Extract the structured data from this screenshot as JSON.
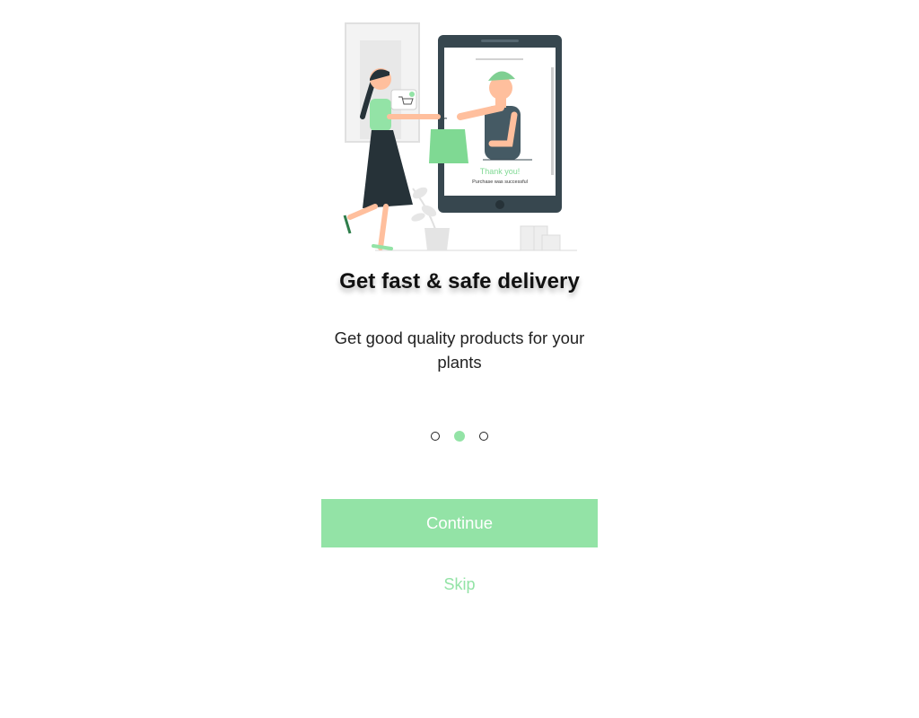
{
  "onboarding": {
    "illustration": {
      "thank_you": "Thank you!",
      "purchase_msg": "Purchase was successful"
    },
    "title": "Get fast & safe delivery",
    "description": "Get good quality products for your plants",
    "pager": {
      "total": 3,
      "active_index": 1
    },
    "continue_label": "Continue",
    "skip_label": "Skip"
  },
  "colors": {
    "accent": "#93e3a6",
    "dark": "#37474f",
    "text": "#111111"
  }
}
